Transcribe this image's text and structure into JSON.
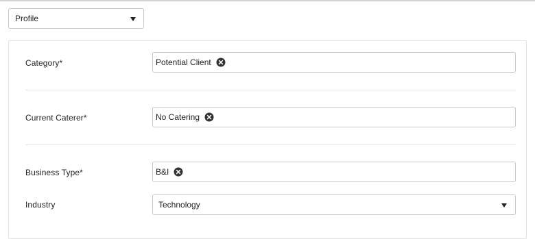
{
  "section_selector": {
    "value": "Profile",
    "icon": "chevron-down-icon"
  },
  "form": {
    "category": {
      "label": "Category*",
      "tags": [
        "Potential Client"
      ]
    },
    "current_caterer": {
      "label": "Current Caterer*",
      "tags": [
        "No Catering"
      ]
    },
    "business_type": {
      "label": "Business Type*",
      "tags": [
        "B&I"
      ]
    },
    "industry": {
      "label": "Industry",
      "value": "Technology",
      "icon": "chevron-down-icon"
    }
  },
  "colors": {
    "border": "#c8c8c8",
    "divider": "#e3e3e3",
    "text": "#222222",
    "remove_icon": "#333333"
  },
  "icons": {
    "tag_remove": "circle-x-icon"
  }
}
